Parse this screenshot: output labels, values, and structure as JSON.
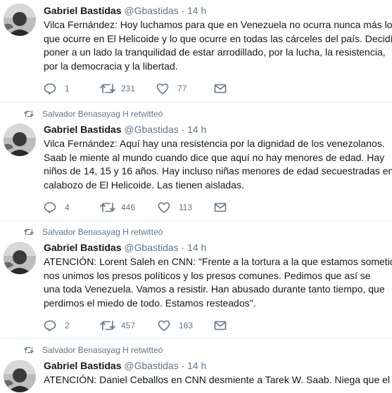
{
  "tweets": [
    {
      "retweeted_by": "",
      "name": "Gabriel Bastidas",
      "handle": "@Gbastidas",
      "dot": "·",
      "time": "14 h",
      "lines": [
        "Vilca Fernández: Hoy luchamos para que en Venezuela no ocurra nunca más lo",
        "que ocurre en El Helicoide y lo que ocurre en todas las cárceles del país. Decidí",
        "poner a un lado la tranquilidad de estar arrodillado, por la lucha, la resistencia,",
        "por la democracia y la libertad."
      ],
      "replies": "1",
      "retweets": "231",
      "likes": "77"
    },
    {
      "retweeted_by": "Salvador Benasayag H retwitteó",
      "name": "Gabriel Bastidas",
      "handle": "@Gbastidas",
      "dot": "·",
      "time": "14 h",
      "lines": [
        "Vilca Fernández: Aquí hay una resistencia por la dignidad de los venezolanos.",
        "Saab le miente al mundo cuando dice que aquí no hay menores de edad. Hay",
        "niños de 14, 15 y 16 años. Hay incluso niñas menores de edad secuestradas en lo",
        "calabozo de El Helicoide. Las tienen aisladas."
      ],
      "replies": "4",
      "retweets": "446",
      "likes": "113"
    },
    {
      "retweeted_by": "Salvador Benasayag H retwitteó",
      "name": "Gabriel Bastidas",
      "handle": "@Gbastidas",
      "dot": "·",
      "time": "14 h",
      "lines": [
        "ATENCIÓN: Lorent Saleh en CNN: \"Frente a la tortura a la que estamos sometido",
        "nos unimos los presos políticos y los presos comunes. Pedimos que así se",
        "una toda Venezuela. Vamos a resistir. Han abusado durante tanto tiempo, que",
        "perdimos el miedo de todo. Estamos resteados\"."
      ],
      "replies": "2",
      "retweets": "457",
      "likes": "163"
    },
    {
      "retweeted_by": "Salvador Benasayag H retwitteó",
      "name": "Gabriel Bastidas",
      "handle": "@Gbastidas",
      "dot": "·",
      "time": "14 h",
      "lines": [
        "ATENCIÓN: Daniel Ceballos en CNN desmiente a Tarek W. Saab. Niega que el"
      ],
      "replies": "",
      "retweets": "",
      "likes": ""
    }
  ]
}
